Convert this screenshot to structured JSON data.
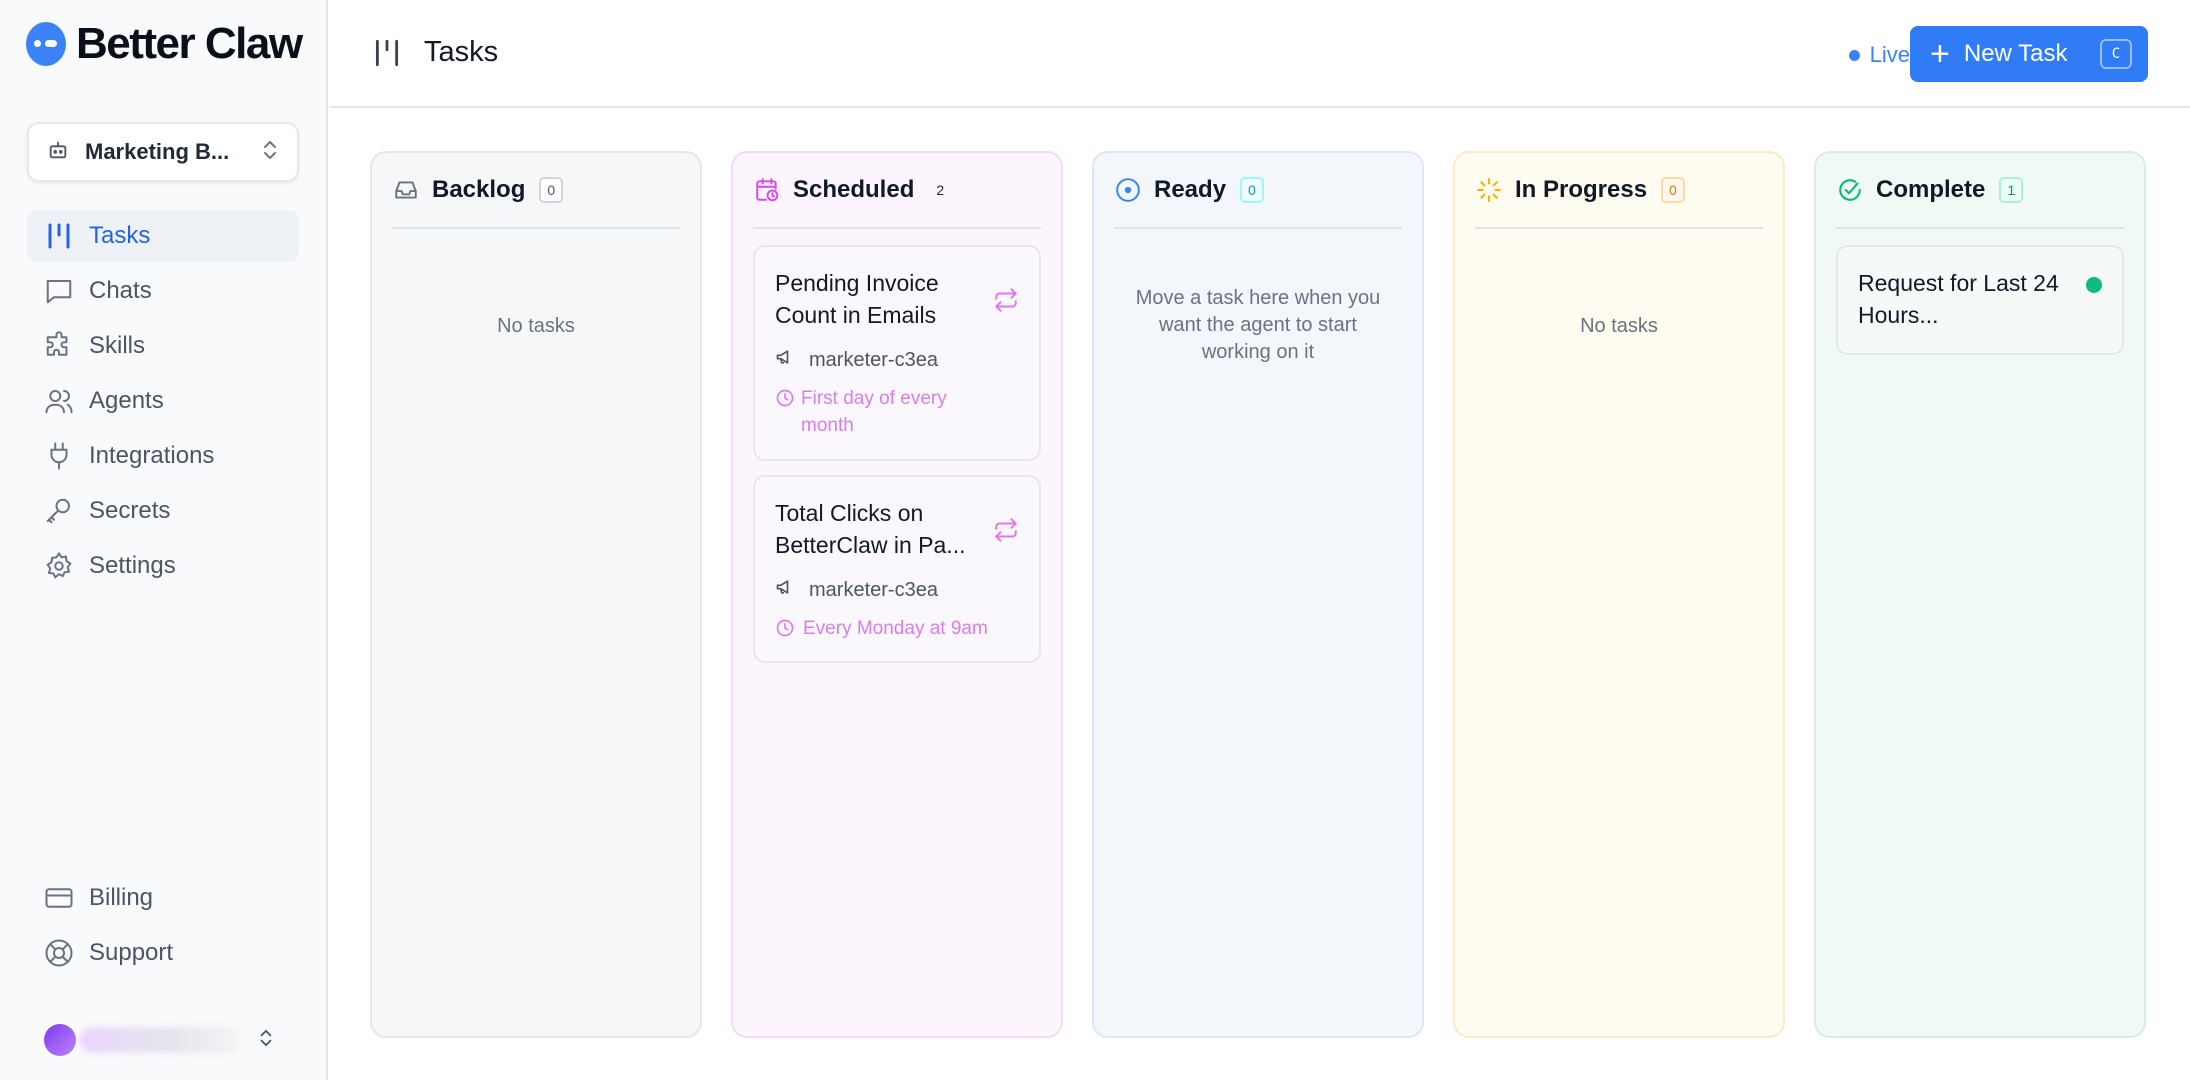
{
  "app": {
    "logo_text": "Better Claw",
    "accent": "#2f7cf6"
  },
  "sidebar": {
    "workspace": "Marketing B...",
    "items": [
      {
        "label": "Tasks",
        "icon": "kanban-icon",
        "active": true
      },
      {
        "label": "Chats",
        "icon": "chat-bubble-icon"
      },
      {
        "label": "Skills",
        "icon": "puzzle-icon"
      },
      {
        "label": "Agents",
        "icon": "users-icon"
      },
      {
        "label": "Integrations",
        "icon": "plug-icon"
      },
      {
        "label": "Secrets",
        "icon": "key-icon"
      },
      {
        "label": "Settings",
        "icon": "gear-icon"
      }
    ],
    "bottom_items": [
      {
        "label": "Billing",
        "icon": "credit-card-icon"
      },
      {
        "label": "Support",
        "icon": "lifebuoy-icon"
      }
    ]
  },
  "header": {
    "title": "Tasks",
    "live_label": "Live",
    "new_task_label": "New Task",
    "new_task_shortcut": "C"
  },
  "columns": [
    {
      "title": "Backlog",
      "count": "0",
      "empty_text": "No tasks",
      "color": "#6b7280"
    },
    {
      "title": "Scheduled",
      "count": "2",
      "color": "#d946ef",
      "cards": [
        {
          "title": "Pending Invoice Count in Emails",
          "agent": "marketer-c3ea",
          "schedule": "First day of every month"
        },
        {
          "title": "Total Clicks on BetterClaw in Pa...",
          "agent": "marketer-c3ea",
          "schedule": "Every Monday at 9am"
        }
      ]
    },
    {
      "title": "Ready",
      "count": "0",
      "empty_text": "Move a task here when you want the agent to start working on it",
      "color": "#3b82f6"
    },
    {
      "title": "In Progress",
      "count": "0",
      "empty_text": "No tasks",
      "color": "#f59e0b"
    },
    {
      "title": "Complete",
      "count": "1",
      "color": "#10b981",
      "cards": [
        {
          "title": "Request for Last 24 Hours..."
        }
      ]
    }
  ]
}
